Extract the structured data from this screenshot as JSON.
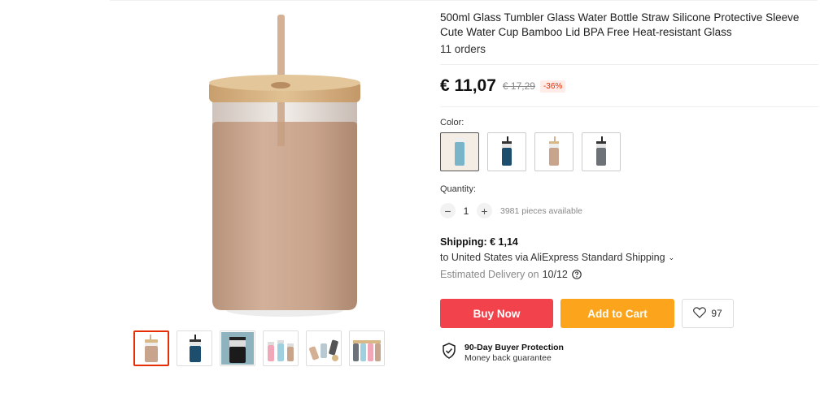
{
  "product": {
    "title": "500ml Glass Tumbler Glass Water Bottle Straw Silicone Protective Sleeve Cute Water Cup Bamboo Lid BPA Free Heat-resistant Glass",
    "orders": "11 orders"
  },
  "price": {
    "current": "€ 11,07",
    "original": "€ 17,29",
    "discount": "-36%"
  },
  "color": {
    "label": "Color:",
    "options": [
      "beige",
      "blue",
      "pink",
      "grey"
    ],
    "selected": "beige",
    "sleeve_colors": [
      "#7ab4c8",
      "#1d4e6e",
      "#c9a48c",
      "#6d7278"
    ]
  },
  "quantity": {
    "label": "Quantity:",
    "value": "1",
    "minus": "−",
    "plus": "+",
    "available": "3981 pieces available"
  },
  "shipping": {
    "title": "Shipping: € 1,14",
    "destination": "to United States via AliExpress Standard Shipping",
    "delivery_label": "Estimated Delivery on",
    "delivery_date": "10/12"
  },
  "actions": {
    "buy_now": "Buy Now",
    "add_to_cart": "Add to Cart",
    "wishlist_count": "97"
  },
  "protection": {
    "title": "90-Day Buyer Protection",
    "subtitle": "Money back guarantee"
  },
  "colors": {
    "buy": "#f2434c",
    "cart": "#fba41c",
    "discount": "#e62e04",
    "sleeve_main": "#c9a48c"
  },
  "thumbnails": [
    "tumbler-beige",
    "tumbler-blue",
    "tumbler-set",
    "tumbler-pastel",
    "tumbler-group",
    "tumbler-row"
  ]
}
